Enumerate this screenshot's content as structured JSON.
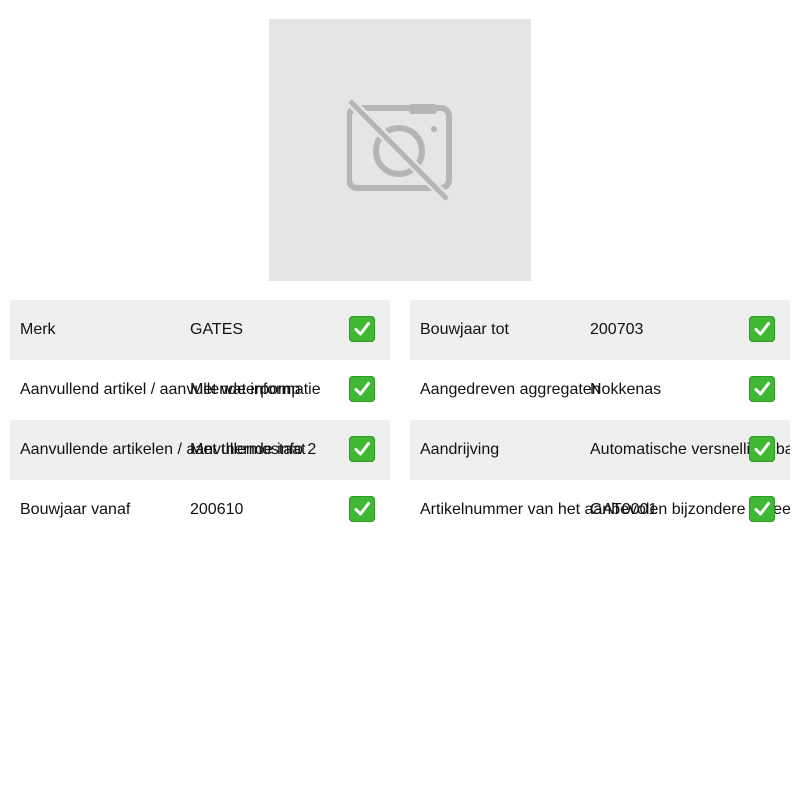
{
  "product_image": {
    "icon": "no-photo-icon"
  },
  "specs_left": [
    {
      "label": "Merk",
      "value": "GATES"
    },
    {
      "label": "Aanvullend artikel / aanvullende informatie",
      "value": "Met waterpomp"
    },
    {
      "label": "Aanvullende artikelen / aanvullende info 2",
      "value": "Met thermostaat"
    },
    {
      "label": "Bouwjaar vanaf",
      "value": "200610"
    }
  ],
  "specs_right": [
    {
      "label": "Bouwjaar tot",
      "value": "200703"
    },
    {
      "label": "Aangedreven aggregaten",
      "value": "Nokkenas"
    },
    {
      "label": "Aandrijving",
      "value": "Automatische versnellingsbak"
    },
    {
      "label": "Artikelnummer van het aanbevolen bijzondere gereedschap",
      "value": "GAT0001"
    }
  ],
  "check_icon": "check-mark-icon",
  "colors": {
    "row_shade": "#efefef",
    "check": "#3fb934",
    "placeholder": "#e5e5e5"
  }
}
